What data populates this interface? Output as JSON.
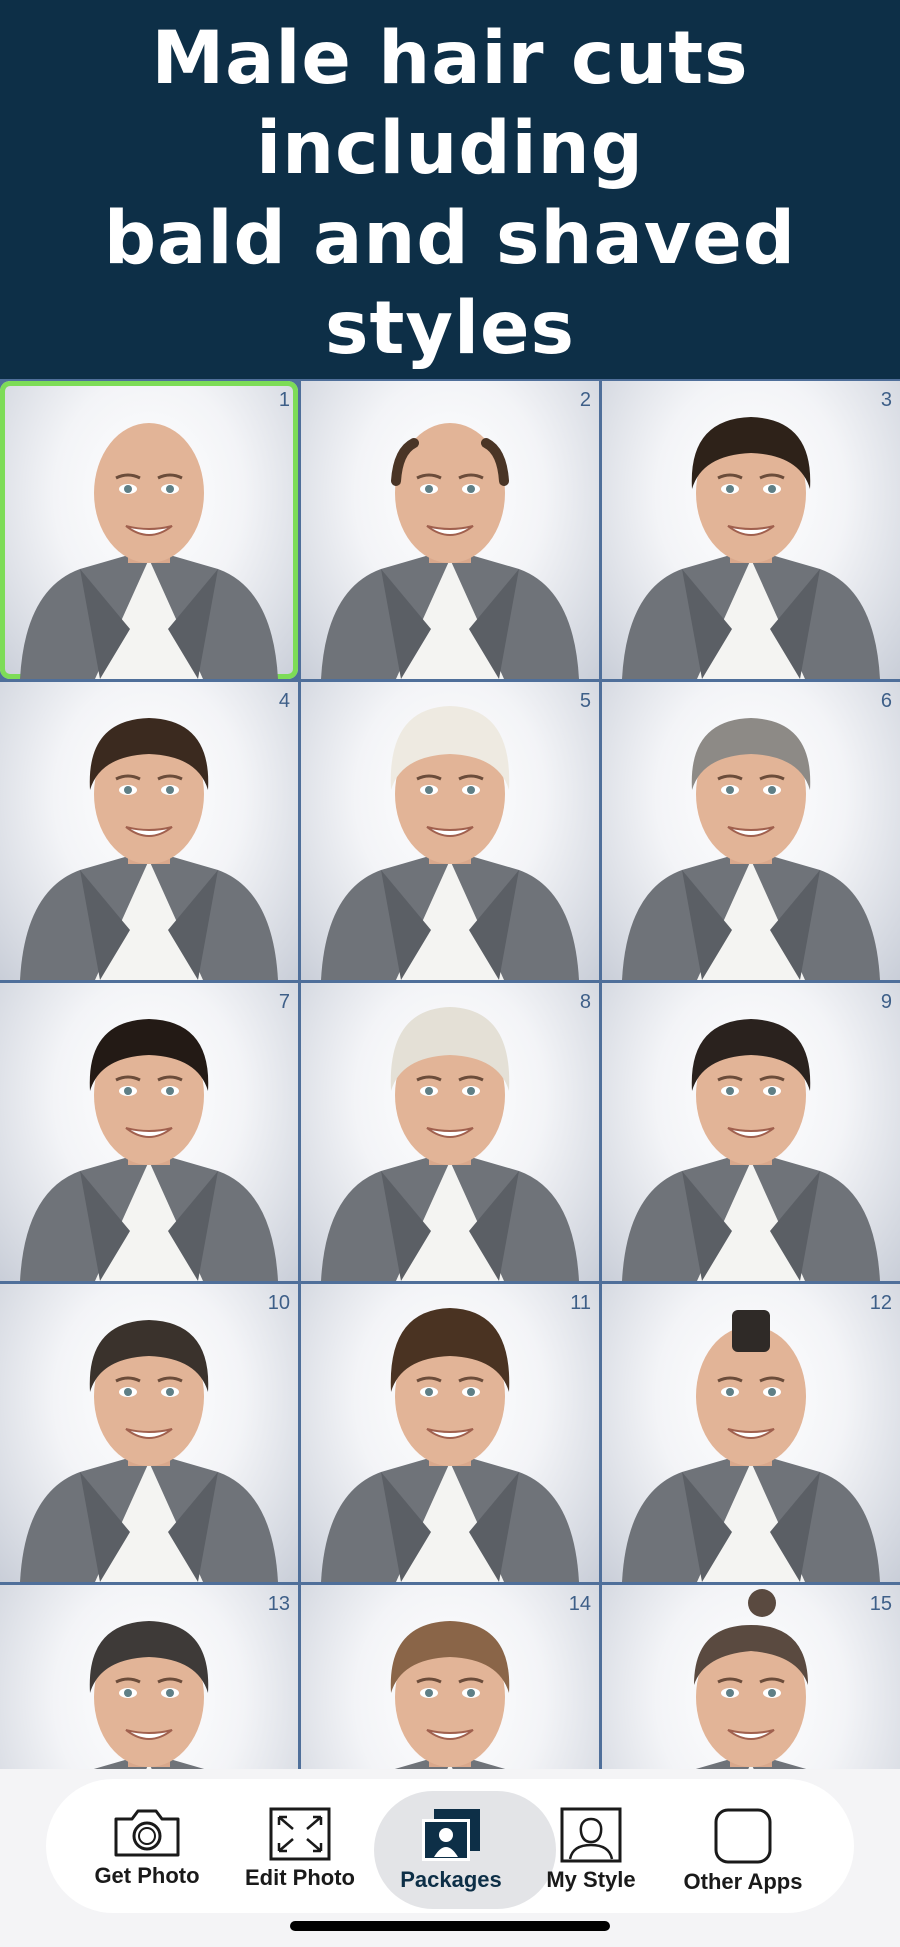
{
  "header": {
    "title": "Male hair cuts including\nbald and shaved styles"
  },
  "grid": {
    "items": [
      {
        "number": "1",
        "hair": "bald"
      },
      {
        "number": "2",
        "hair": "balding"
      },
      {
        "number": "3",
        "hair": "slick-brown"
      },
      {
        "number": "4",
        "hair": "short-brown"
      },
      {
        "number": "5",
        "hair": "blonde-messy"
      },
      {
        "number": "6",
        "hair": "grey-short"
      },
      {
        "number": "7",
        "hair": "dark-short"
      },
      {
        "number": "8",
        "hair": "platinum"
      },
      {
        "number": "9",
        "hair": "fade-lines"
      },
      {
        "number": "10",
        "hair": "buzz"
      },
      {
        "number": "11",
        "hair": "curly"
      },
      {
        "number": "12",
        "hair": "mohawk"
      },
      {
        "number": "13",
        "hair": "cornrows"
      },
      {
        "number": "14",
        "hair": "light-brown-design"
      },
      {
        "number": "15",
        "hair": "bun"
      }
    ],
    "selected_index": 0
  },
  "tabbar": {
    "tabs": [
      {
        "label": "Get Photo",
        "icon": "camera-icon"
      },
      {
        "label": "Edit Photo",
        "icon": "resize-icon"
      },
      {
        "label": "Packages",
        "icon": "packages-icon"
      },
      {
        "label": "My Style",
        "icon": "person-outline-icon"
      },
      {
        "label": "Other Apps",
        "icon": "rounded-square-icon"
      }
    ],
    "active": "Packages"
  },
  "colors": {
    "header_bg": "#0d2f47",
    "selection": "#7ddc57",
    "grid_line": "#4f6f9a",
    "number": "#3e5f88"
  }
}
